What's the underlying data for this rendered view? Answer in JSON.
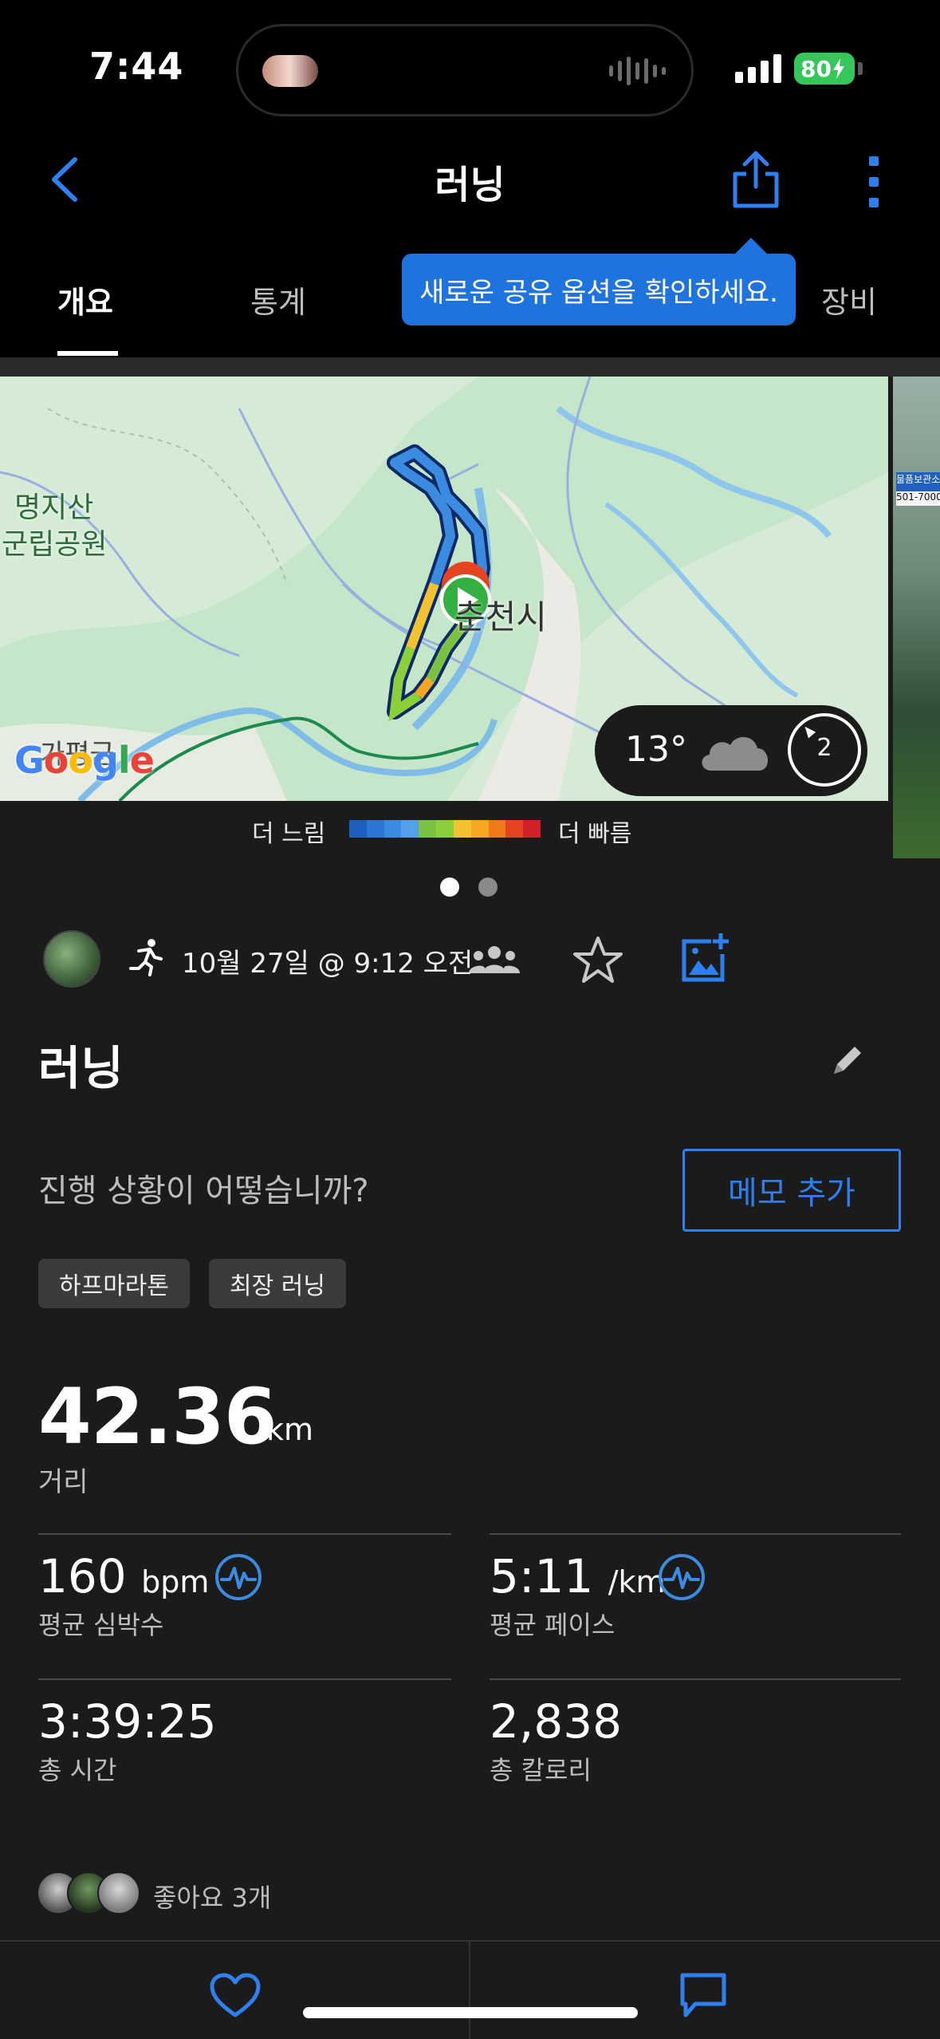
{
  "status_bar": {
    "time": "7:44",
    "battery": "80"
  },
  "header": {
    "title": "러닝"
  },
  "tabs": [
    {
      "label": "개요",
      "active": true
    },
    {
      "label": "통계",
      "active": false
    },
    {
      "label": "장비",
      "active": false
    }
  ],
  "tooltip": {
    "text": "새로운 공유 옵션을 확인하세요."
  },
  "map": {
    "park_label_line1": "명지산",
    "park_label_line2": "군립공원",
    "city_label": "춘천시",
    "area_label": "가평군",
    "google": "Google",
    "weather": {
      "temp": "13°",
      "icon": "cloud-icon",
      "badge": "2"
    },
    "legend": {
      "slow": "더 느림",
      "fast": "더 빠름",
      "colors": [
        "#1f5fbf",
        "#2c76d6",
        "#3b8ce0",
        "#55a0e8",
        "#7cc242",
        "#8bcf3a",
        "#f2c230",
        "#f5a623",
        "#f07a1a",
        "#e4441f",
        "#d1202a"
      ]
    },
    "photo_banner_1": "물품보관소",
    "photo_banner_2": "501-7000"
  },
  "pager": {
    "count": 2,
    "active": 0
  },
  "activity": {
    "date": "10월 27일 @ 9:12 오전",
    "title": "러닝",
    "progress_prompt": "진행 상황이 어떻습니까?",
    "memo_button": "메모 추가",
    "tags": [
      "하프마라톤",
      "최장 러닝"
    ]
  },
  "stats": {
    "distance": {
      "value": "42.36",
      "unit": "km",
      "label": "거리"
    },
    "heart_rate": {
      "value": "160",
      "unit": "bpm",
      "label": "평균 심박수"
    },
    "pace": {
      "value": "5:11",
      "unit": "/km",
      "label": "평균 페이스"
    },
    "time": {
      "value": "3:39:25",
      "label": "총 시간"
    },
    "calories": {
      "value": "2,838",
      "label": "총 칼로리"
    }
  },
  "likes": {
    "text": "좋아요 3개"
  },
  "colors": {
    "accent": "#2e7ff0",
    "background": "#1b1b1b",
    "tooltip": "#1f73df"
  }
}
